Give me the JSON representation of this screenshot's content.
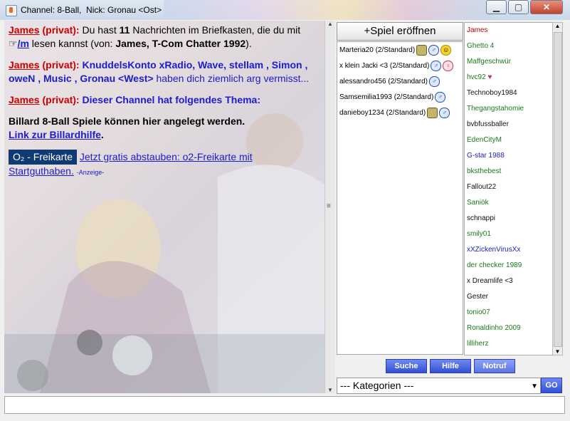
{
  "window": {
    "title": "Channel: 8-Ball,  Nick: Gronau <Ost>"
  },
  "chat": {
    "m1": {
      "sender": "James",
      "tag": "(privat):",
      "t1": " Du hast ",
      "count": "11",
      "t2": " Nachrichten im Briefkasten, die du mit ",
      "cmd": "/m",
      "t3": " lesen kannst (von: ",
      "from": "James, T-Com Chatter 1992",
      "t4": ")."
    },
    "m2": {
      "sender": "James",
      "tag": "(privat):",
      "names": "KnuddelsKonto xRadio,     Wave, stellam         , Simon          ,        oweN   , Music      , Gronau <West>",
      "rest": " haben dich ziemlich arg vermisst..."
    },
    "m3": {
      "sender": "James",
      "tag": "(privat):",
      "text": " Dieser Channel hat folgendes Thema:"
    },
    "topic": "Billard 8-Ball Spiele können hier angelegt werden.",
    "help_link": "Link zur Billardhilfe",
    "help_dot": ".",
    "ad_logo": "O₂  - Freikarte",
    "ad_link": "Jetzt gratis abstauben: o2-Freikarte mit Startguthaben.",
    "ad_tag": "-Anzeige-"
  },
  "games": {
    "open_button": "+Spiel eröffnen",
    "rows": [
      {
        "label": "Marteria20 (2/Standard)"
      },
      {
        "label": "x klein Jacki <3 (2/Standard)"
      },
      {
        "label": "alessandro456 (2/Standard)"
      },
      {
        "label": "Samsemilia1993 (2/Standard)"
      },
      {
        "label": "danieboy1234 (2/Standard)"
      }
    ]
  },
  "users": [
    {
      "name": "James",
      "color": "#cc0000"
    },
    {
      "name": "Ghetto 4",
      "color": "#1a7a1a"
    },
    {
      "name": "Maffgeschwür",
      "color": "#1a7a1a"
    },
    {
      "name": "hvc92",
      "color": "#1a7a1a"
    },
    {
      "name": "Technoboy1984",
      "color": "#111111"
    },
    {
      "name": "Thegangstahomie",
      "color": "#1a7a1a"
    },
    {
      "name": "bvbfussballer",
      "color": "#111111"
    },
    {
      "name": "EdenCityM",
      "color": "#1a7a1a"
    },
    {
      "name": "G-star 1988",
      "color": "#2020c0"
    },
    {
      "name": "bksthebest",
      "color": "#1a7a1a"
    },
    {
      "name": "Fallout22",
      "color": "#111111"
    },
    {
      "name": "Saniök",
      "color": "#1a7a1a"
    },
    {
      "name": "schnappi",
      "color": "#111111"
    },
    {
      "name": "smily01",
      "color": "#1a7a1a"
    },
    {
      "name": "xXZickenVirusXx",
      "color": "#2020c0"
    },
    {
      "name": "der checker 1989",
      "color": "#1a7a1a"
    },
    {
      "name": "x Dreamlife <3",
      "color": "#111111"
    },
    {
      "name": "Gester",
      "color": "#111111"
    },
    {
      "name": "tonio07",
      "color": "#1a7a1a"
    },
    {
      "name": "Ronaldinho 2009",
      "color": "#1a7a1a"
    },
    {
      "name": "lilliherz",
      "color": "#1a7a1a"
    }
  ],
  "buttons": {
    "suche": "Suche",
    "hilfe": "Hilfe",
    "notruf": "Notruf",
    "go": "GO"
  },
  "kategorien": "--- Kategorien ---"
}
